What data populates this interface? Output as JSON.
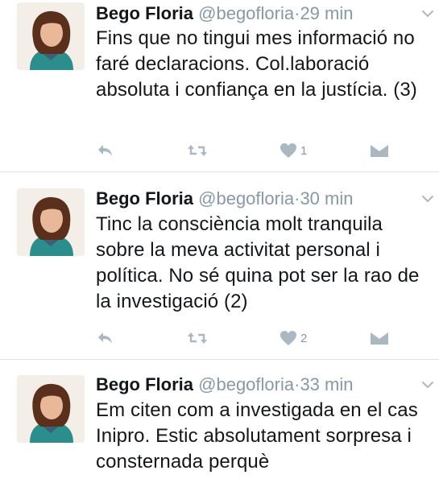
{
  "tweets": [
    {
      "name": "Bego Floria",
      "handle": "@begofloria",
      "separator": "·",
      "time": "29 min",
      "text": "Fins que no tingui mes informació no faré declaracions. Col.laboració absoluta i confiança en la justícia. (3)",
      "likes": "1"
    },
    {
      "name": "Bego Floria",
      "handle": "@begofloria",
      "separator": "·",
      "time": "30 min",
      "text": "Tinc la consciència molt tranquila sobre la meva activitat personal i política. No sé quina pot ser la rao de la investigació (2)",
      "likes": "2"
    },
    {
      "name": "Bego Floria",
      "handle": "@begofloria",
      "separator": "·",
      "time": "33 min",
      "text": "Em citen com a investigada en el cas Inipro. Estic absolutament sorpresa i consternada perquè",
      "likes": ""
    }
  ],
  "colors": {
    "icon_gray": "#aab8c2",
    "meta_gray": "#8899a6",
    "divider": "#dfe3e6",
    "text": "#14171a"
  },
  "icons": [
    "reply-icon",
    "retweet-icon",
    "heart-icon",
    "direct-message-icon",
    "chevron-down-icon"
  ]
}
